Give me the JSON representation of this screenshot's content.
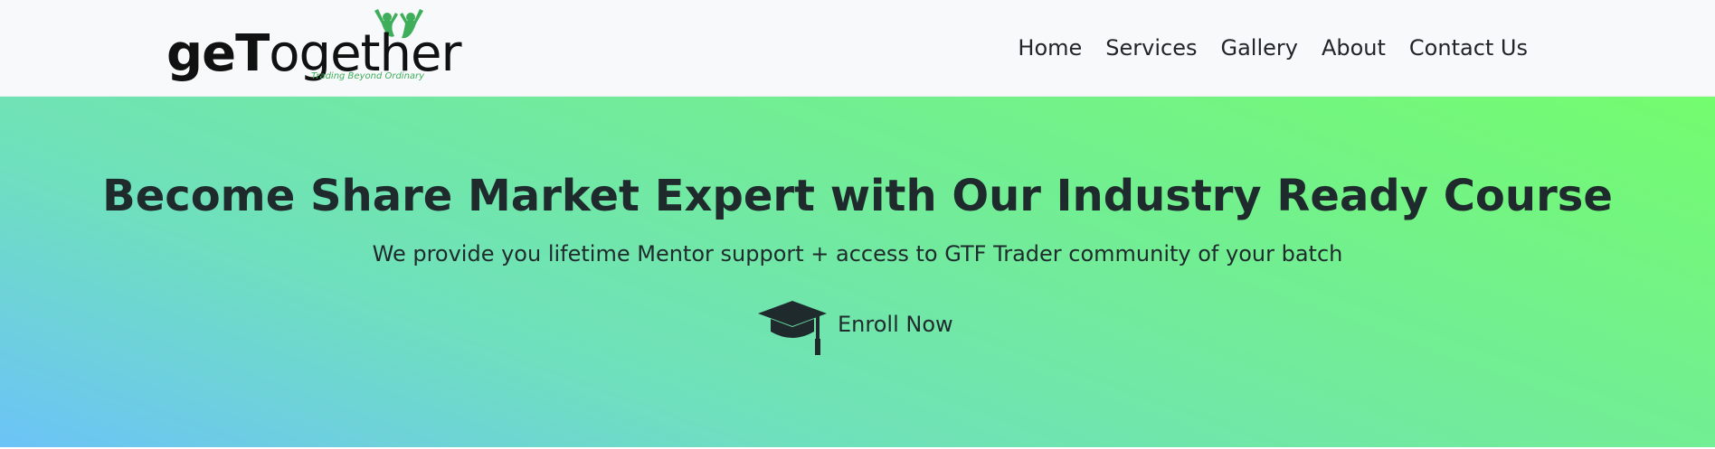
{
  "brand": {
    "name_part1": "ge",
    "name_part2": "T",
    "name_part3": "ogether",
    "tagline": "Trading Beyond Ordinary",
    "logo_icon": "people-raising-hands-icon",
    "logo_color": "#3fae5a"
  },
  "nav": {
    "items": [
      {
        "label": "Home"
      },
      {
        "label": "Services"
      },
      {
        "label": "Gallery"
      },
      {
        "label": "About"
      },
      {
        "label": "Contact Us"
      }
    ]
  },
  "hero": {
    "title": "Become Share Market Expert with Our Industry Ready Course",
    "subtitle": "We provide you lifetime Mentor support + access to GTF Trader community of your batch",
    "cta_label": "Enroll Now",
    "cta_icon": "graduation-cap-icon",
    "gradient_colors": [
      "#6cc3f7",
      "#6fe0bd",
      "#74fc6e"
    ]
  }
}
